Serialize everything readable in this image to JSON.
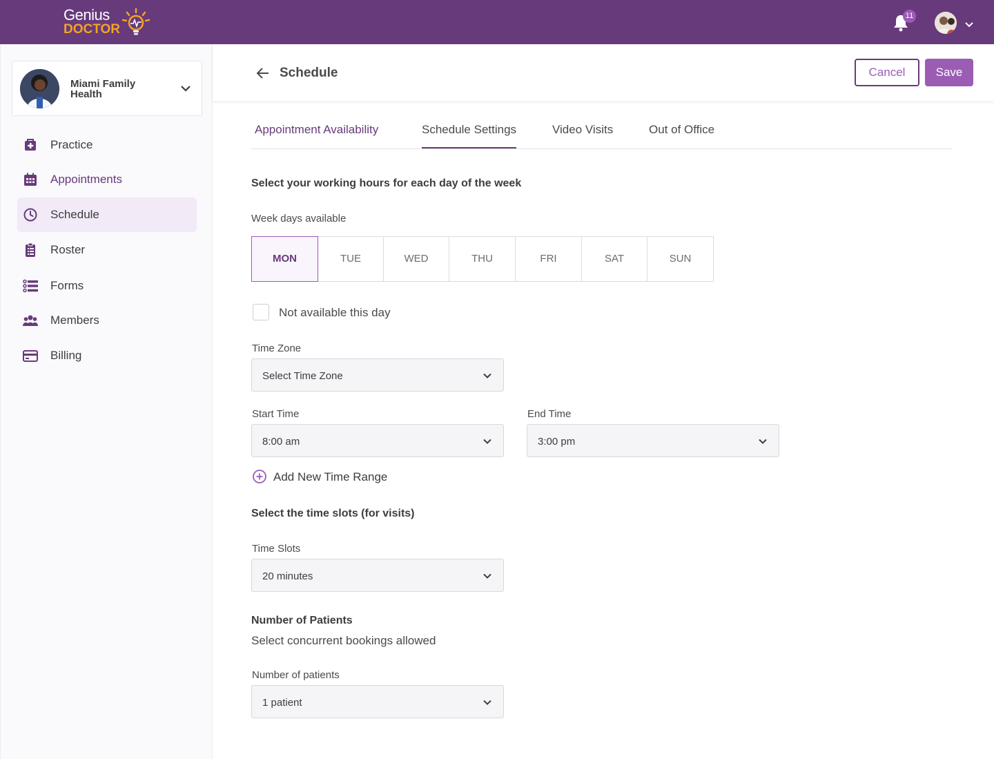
{
  "brand": {
    "line1": "Genius",
    "line2": "DOCTOR"
  },
  "notifications": {
    "count": "11"
  },
  "org": {
    "name": "Miami Family Health"
  },
  "nav": [
    {
      "label": "Practice",
      "icon": "medical-bag-icon"
    },
    {
      "label": "Appointments",
      "icon": "calendar-icon"
    },
    {
      "label": "Schedule",
      "icon": "clock-icon"
    },
    {
      "label": "Roster",
      "icon": "clipboard-icon"
    },
    {
      "label": "Forms",
      "icon": "list-icon"
    },
    {
      "label": "Members",
      "icon": "members-icon"
    },
    {
      "label": "Billing",
      "icon": "credit-card-icon"
    }
  ],
  "header": {
    "title": "Schedule",
    "cancel_label": "Cancel",
    "save_label": "Save"
  },
  "tabs": [
    "Appointment Availability",
    "Schedule Settings",
    "Video Visits",
    "Out of Office"
  ],
  "active_tab": "Schedule Settings",
  "working_hours": {
    "title": "Select your working hours for each day of the week",
    "weekdays_label": "Week days available",
    "days": [
      "MON",
      "TUE",
      "WED",
      "THU",
      "FRI",
      "SAT",
      "SUN"
    ],
    "selected_day": "MON",
    "not_available_label": "Not available this day",
    "not_available_checked": false,
    "timezone_label": "Time Zone",
    "timezone_value": "Select Time Zone",
    "start_label": "Start Time",
    "start_value": "8:00 am",
    "end_label": "End Time",
    "end_value": "3:00 pm",
    "add_range_label": "Add New Time Range"
  },
  "time_slots": {
    "title": "Select the time slots (for visits)",
    "label": "Time Slots",
    "value": "20 minutes"
  },
  "patients": {
    "title": "Number of Patients",
    "subtitle": "Select concurrent bookings allowed",
    "label": "Number of patients",
    "value": "1 patient"
  },
  "colors": {
    "brand_purple": "#673a7b",
    "accent_purple": "#9b5cb4",
    "logo_orange": "#f4a323"
  }
}
